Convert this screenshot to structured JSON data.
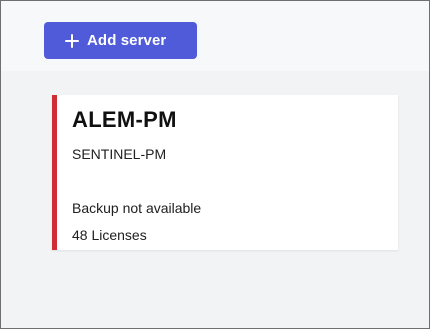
{
  "toolbar": {
    "add_server_label": "Add server",
    "add_icon": "plus-icon",
    "button_color": "#4f5bd9"
  },
  "server_card": {
    "name": "ALEM-PM",
    "host": "SENTINEL-PM",
    "backup_status": "Backup not available",
    "licenses": "48 Licenses",
    "status_color": "#cf2d35"
  }
}
